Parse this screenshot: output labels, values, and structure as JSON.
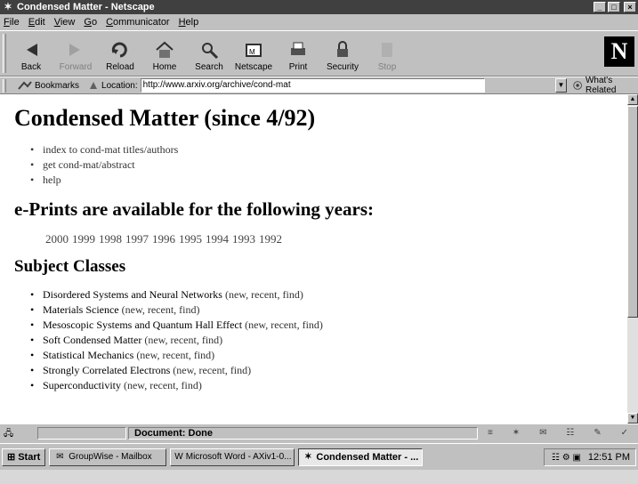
{
  "window": {
    "title": "Condensed Matter - Netscape",
    "controls": {
      "minimize": "_",
      "maximize": "□",
      "close": "×"
    }
  },
  "menu": [
    {
      "key": "F",
      "rest": "ile"
    },
    {
      "key": "E",
      "rest": "dit"
    },
    {
      "key": "V",
      "rest": "iew"
    },
    {
      "key": "G",
      "rest": "o"
    },
    {
      "key": "C",
      "rest": "ommunicator"
    },
    {
      "key": "H",
      "rest": "elp"
    }
  ],
  "toolbar": {
    "buttons": [
      {
        "label": "Back",
        "icon": "back-arrow-icon",
        "enabled": true
      },
      {
        "label": "Forward",
        "icon": "forward-arrow-icon",
        "enabled": false
      },
      {
        "label": "Reload",
        "icon": "reload-icon",
        "enabled": true
      },
      {
        "label": "Home",
        "icon": "home-icon",
        "enabled": true
      },
      {
        "label": "Search",
        "icon": "search-icon",
        "enabled": true
      },
      {
        "label": "Netscape",
        "icon": "netscape-icon",
        "enabled": true
      },
      {
        "label": "Print",
        "icon": "print-icon",
        "enabled": true
      },
      {
        "label": "Security",
        "icon": "lock-icon",
        "enabled": true
      },
      {
        "label": "Stop",
        "icon": "stop-icon",
        "enabled": false
      }
    ],
    "logo": "N"
  },
  "location": {
    "bookmarks_label": "Bookmarks",
    "location_label": "Location:",
    "url": "http://www.arxiv.org/archive/cond-mat",
    "related_label": "What's Related"
  },
  "page": {
    "heading": "Condensed Matter (since 4/92)",
    "top_links": [
      "index to cond-mat titles/authors",
      "get cond-mat/abstract",
      "help"
    ],
    "eprints_heading": "e-Prints are available for the following years:",
    "years": [
      "2000",
      "1999",
      "1998",
      "1997",
      "1996",
      "1995",
      "1994",
      "1993",
      "1992"
    ],
    "subjects_heading": "Subject Classes",
    "subjects": [
      {
        "name": "Disordered Systems and Neural Networks",
        "links": "(new, recent, find)"
      },
      {
        "name": "Materials Science",
        "links": "(new, recent, find)"
      },
      {
        "name": "Mesoscopic Systems and Quantum Hall Effect",
        "links": "(new, recent, find)"
      },
      {
        "name": "Soft Condensed Matter",
        "links": "(new, recent, find)"
      },
      {
        "name": "Statistical Mechanics",
        "links": "(new, recent, find)"
      },
      {
        "name": "Strongly Correlated Electrons",
        "links": "(new, recent, find)"
      },
      {
        "name": "Superconductivity",
        "links": "(new, recent, find)"
      }
    ]
  },
  "status": {
    "text": "Document: Done"
  },
  "taskbar": {
    "start_label": "Start",
    "tasks": [
      {
        "label": "GroupWise - Mailbox",
        "icon": "groupwise-icon",
        "active": false
      },
      {
        "label": "Microsoft Word - AXiv1-0...",
        "icon": "word-icon",
        "active": false
      },
      {
        "label": "Condensed Matter - ...",
        "icon": "netscape-icon",
        "active": true
      }
    ],
    "clock": "12:51 PM"
  }
}
